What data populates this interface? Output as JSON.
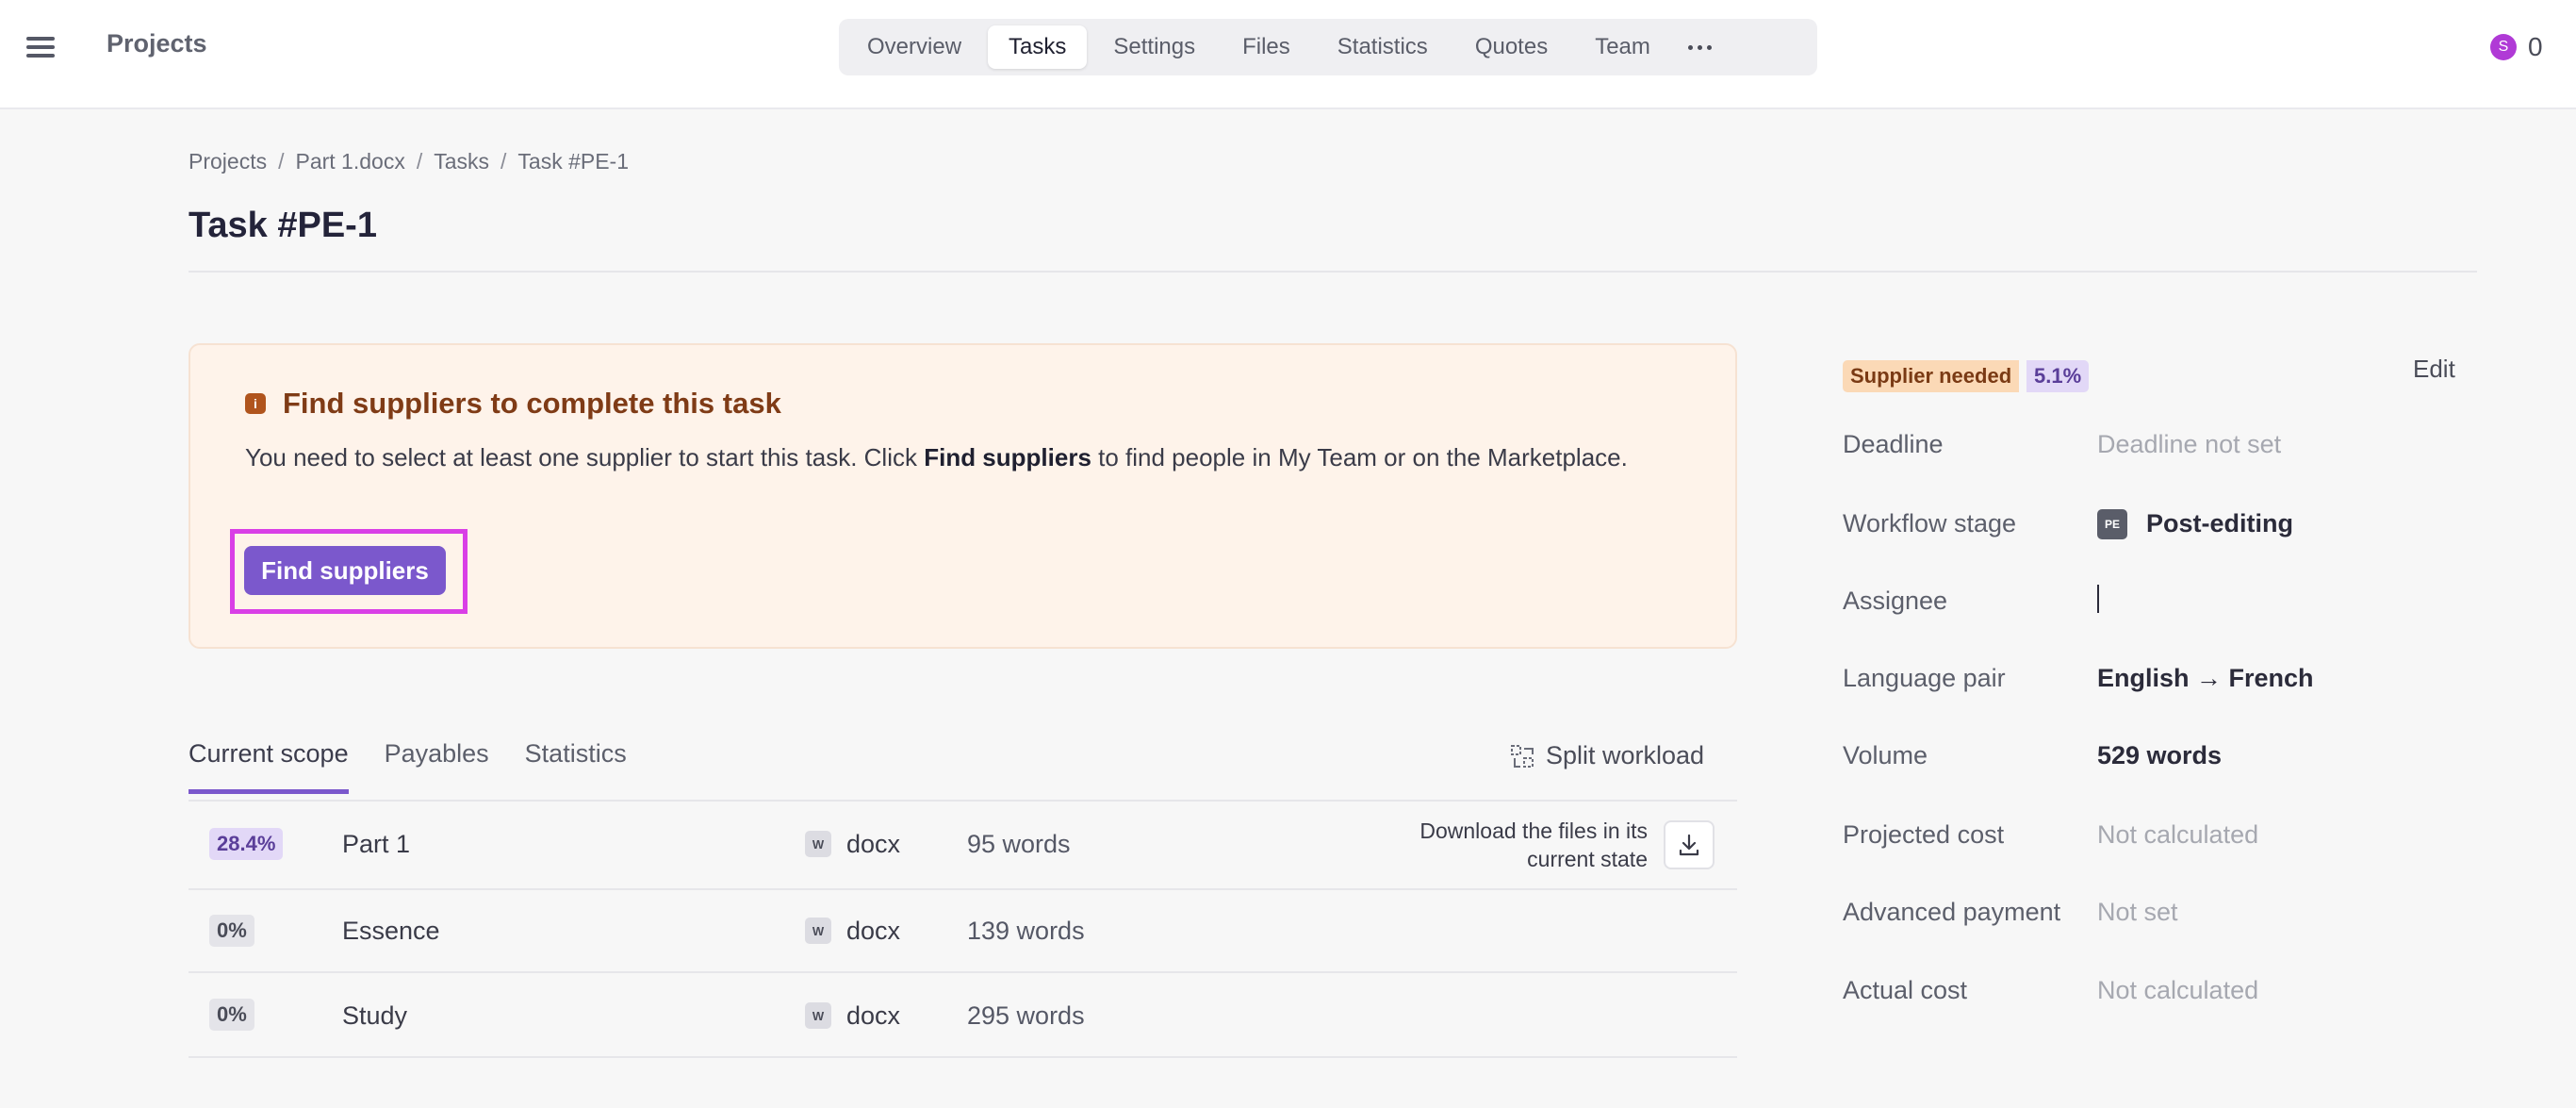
{
  "app": {
    "title": "Projects"
  },
  "nav": {
    "tabs": [
      {
        "label": "Overview"
      },
      {
        "label": "Tasks",
        "active": true
      },
      {
        "label": "Settings"
      },
      {
        "label": "Files"
      },
      {
        "label": "Statistics"
      },
      {
        "label": "Quotes"
      },
      {
        "label": "Team"
      }
    ],
    "more_icon": "more-dots-icon"
  },
  "user": {
    "avatar_letter": "S",
    "count": "0",
    "avatar_color": "#b03ad6"
  },
  "breadcrumb": [
    "Projects",
    "Part 1.docx",
    "Tasks",
    "Task #PE-1"
  ],
  "page": {
    "title": "Task #PE-1"
  },
  "alert": {
    "icon": "info-icon",
    "title": "Find suppliers to complete this task",
    "text_before": "You need to select at least one supplier to start this task. Click ",
    "text_bold": "Find suppliers",
    "text_after": " to find people in My Team or on the Marketplace.",
    "button_label": "Find suppliers",
    "accent": "#7b58cc",
    "highlight": "#d93fe6"
  },
  "scope": {
    "tabs": [
      "Current scope",
      "Payables",
      "Statistics"
    ],
    "split_label": "Split workload",
    "download_text": "Download the files in its current state",
    "files": [
      {
        "pct": "28.4%",
        "name": "Part 1",
        "icon": "W",
        "ext": "docx",
        "words": "95 words"
      },
      {
        "pct": "0%",
        "name": "Essence",
        "icon": "W",
        "ext": "docx",
        "words": "139 words"
      },
      {
        "pct": "0%",
        "name": "Study",
        "icon": "W",
        "ext": "docx",
        "words": "295 words"
      }
    ]
  },
  "panel": {
    "status": "Supplier needed",
    "status_pct": "5.1%",
    "edit_label": "Edit",
    "deadline_label": "Deadline",
    "deadline_value": "Deadline not set",
    "workflow_label": "Workflow stage",
    "workflow_chip": "PE",
    "workflow_value": "Post-editing",
    "assignee_label": "Assignee",
    "language_label": "Language pair",
    "language_value": "English → French",
    "volume_label": "Volume",
    "volume_value": "529 words",
    "projected_label": "Projected cost",
    "projected_value": "Not calculated",
    "advanced_label": "Advanced payment",
    "advanced_value": "Not set",
    "actual_label": "Actual cost",
    "actual_value": "Not calculated"
  }
}
